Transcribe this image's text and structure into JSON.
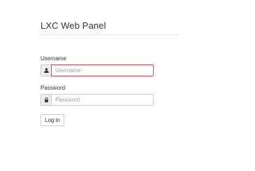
{
  "header": {
    "title": "LXC Web Panel"
  },
  "form": {
    "username": {
      "label": "Username",
      "placeholder": "Username",
      "value": "",
      "icon": "user-icon",
      "state": "error",
      "border_color": "#e3454d"
    },
    "password": {
      "label": "Password",
      "placeholder": "Password",
      "value": "",
      "icon": "lock-icon"
    },
    "submit_label": "Log in"
  }
}
